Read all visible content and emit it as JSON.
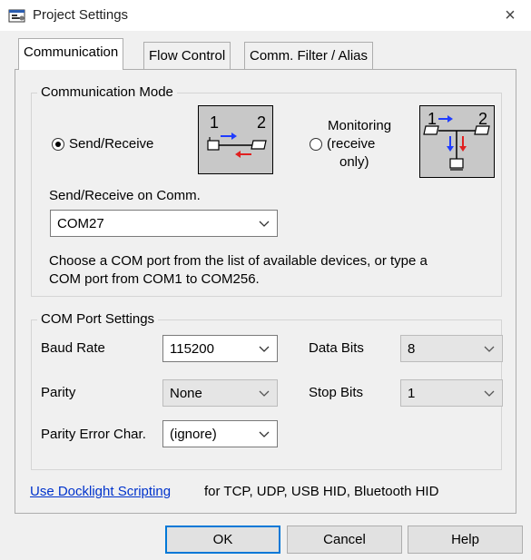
{
  "window": {
    "title": "Project Settings",
    "close_glyph": "×"
  },
  "tabs": [
    {
      "label": "Communication"
    },
    {
      "label": "Flow Control"
    },
    {
      "label": "Comm. Filter / Alias"
    }
  ],
  "communication_mode": {
    "legend": "Communication Mode",
    "send_receive_label": "Send/Receive",
    "monitoring_label": [
      "Monitoring",
      "(receive",
      "only)"
    ],
    "diagram_send_numbers": [
      "1",
      "2"
    ],
    "diagram_monitor_numbers": [
      "1",
      "2"
    ],
    "comm_label": "Send/Receive on Comm.",
    "comm_value": "COM27",
    "help_text": [
      "Choose a COM port from the list of available devices, or type a",
      "COM port from COM1 to COM256."
    ]
  },
  "com_port_settings": {
    "legend": "COM Port Settings",
    "baud_rate_label": "Baud Rate",
    "baud_rate_value": "115200",
    "data_bits_label": "Data Bits",
    "data_bits_value": "8",
    "parity_label": "Parity",
    "parity_value": "None",
    "stop_bits_label": "Stop Bits",
    "stop_bits_value": "1",
    "parity_error_label": "Parity Error Char.",
    "parity_error_value": "(ignore)"
  },
  "scripting": {
    "link_text": "Use Docklight Scripting",
    "suffix_text": "for TCP, UDP, USB HID, Bluetooth HID"
  },
  "buttons": {
    "ok": "OK",
    "cancel": "Cancel",
    "help": "Help"
  },
  "icons": {
    "window": "settings-window-icon",
    "chevron": "chevron-down-icon"
  },
  "colors": {
    "link": "#0033cc",
    "arrow_blue": "#1f3cff",
    "arrow_red": "#e02020",
    "default_button_border": "#0078d7"
  }
}
